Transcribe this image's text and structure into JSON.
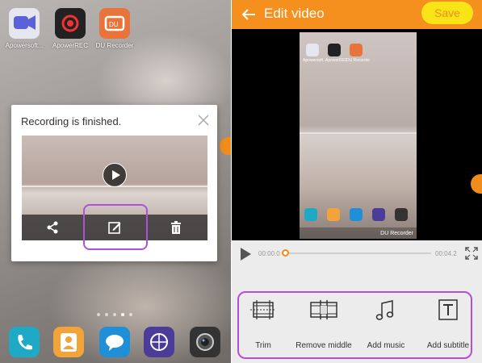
{
  "home_screen": {
    "apps": [
      {
        "label": "Apowersoft...",
        "icon": "video-camera-icon",
        "color": "#e8e8ee"
      },
      {
        "label": "ApowerREC",
        "icon": "record-icon",
        "color": "#222222"
      },
      {
        "label": "DU Recorder",
        "icon": "du-recorder-icon",
        "color": "#e8743b"
      }
    ],
    "dock": [
      {
        "icon": "phone-icon",
        "color": "#1ea9c6"
      },
      {
        "icon": "contacts-icon",
        "color": "#f2a43a"
      },
      {
        "icon": "messages-icon",
        "color": "#1f8fd8"
      },
      {
        "icon": "browser-icon",
        "color": "#4b3c9a"
      },
      {
        "icon": "camera-icon",
        "color": "#333333"
      }
    ]
  },
  "dialog": {
    "title": "Recording is finished.",
    "actions": [
      "share-icon",
      "edit-icon",
      "delete-icon"
    ]
  },
  "editor": {
    "title": "Edit video",
    "save_label": "Save",
    "phone_preview": {
      "apps": [
        "Apowersoft...",
        "ApowerREC",
        "DU Recorder"
      ],
      "du_label": "DU Recorder"
    },
    "player": {
      "current_time": "00:00.0",
      "total_time": "00:04.2",
      "progress": 0.0
    },
    "tools": [
      {
        "label": "Trim",
        "icon": "trim-icon"
      },
      {
        "label": "Remove middle",
        "icon": "remove-middle-icon"
      },
      {
        "label": "Add music",
        "icon": "music-note-icon"
      },
      {
        "label": "Add subtitle",
        "icon": "subtitle-icon"
      }
    ]
  },
  "colors": {
    "accent": "#f5901e",
    "save_bg": "#f9e418",
    "highlight": "#b14fd9"
  }
}
